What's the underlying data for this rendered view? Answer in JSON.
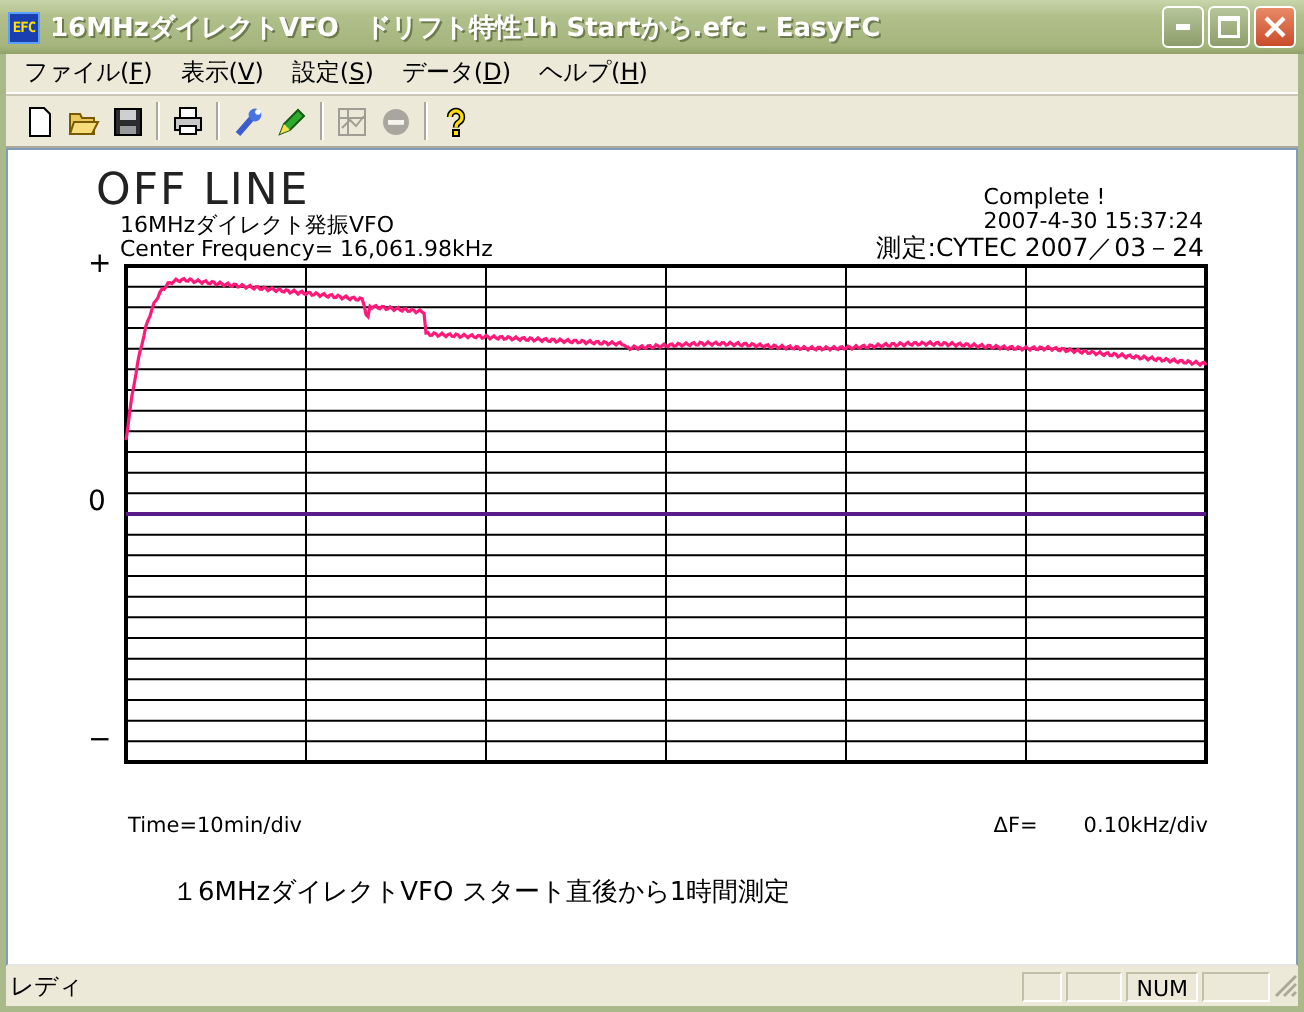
{
  "window": {
    "app_icon": "EFC",
    "title": "16MHzダイレクトVFO　ドリフト特性1h Startから.efc - EasyFC"
  },
  "menu": [
    "ファイル(F)",
    "表示(V)",
    "設定(S)",
    "データ(D)",
    "ヘルプ(H)"
  ],
  "toolbar": [
    [
      {
        "kind": "new",
        "disabled": false
      },
      {
        "kind": "open",
        "disabled": false
      },
      {
        "kind": "save",
        "disabled": false
      }
    ],
    [
      {
        "kind": "print",
        "disabled": false
      }
    ],
    [
      {
        "kind": "wrench",
        "disabled": false
      },
      {
        "kind": "marker",
        "disabled": false
      }
    ],
    [
      {
        "kind": "chart",
        "disabled": true
      },
      {
        "kind": "stop",
        "disabled": true
      }
    ],
    [
      {
        "kind": "help",
        "disabled": false
      }
    ]
  ],
  "report": {
    "status": "OFF LINE",
    "device": "16MHzダイレクト発振VFO",
    "center_frequency": "Center Frequency= 16,061.98kHz",
    "state": "Complete !",
    "timestamp": "2007-4-30  15:37:24",
    "measured_by": "測定:CYTEC 2007／03－24",
    "y_labels": [
      "+",
      "0",
      "−"
    ],
    "time_scale": "Time=10min/div",
    "df_label": "ΔF=",
    "df_scale": "0.10kHz/div",
    "caption": "１6MHzダイレクトVFO  スタート直後から1時間測定"
  },
  "status_bar": {
    "text": "レディ",
    "indicators": [
      "NUM"
    ]
  }
}
